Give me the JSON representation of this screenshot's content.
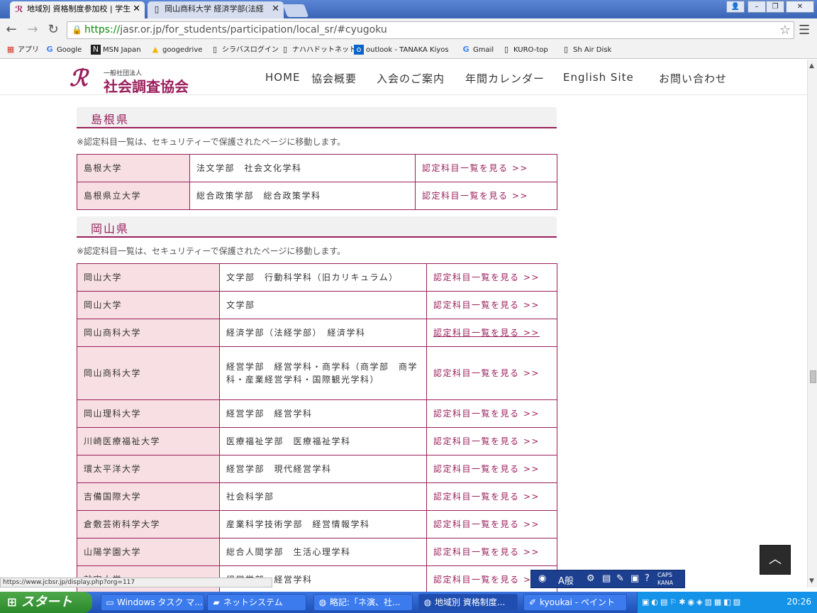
{
  "browser": {
    "tabs": [
      {
        "label": "地域別 資格制度参加校 | 学生",
        "active": true
      },
      {
        "label": "岡山商科大学 経済学部(法経",
        "active": false
      }
    ],
    "address": {
      "scheme": "https://",
      "rest": "jasr.or.jp/for_students/participation/local_sr/#cyugoku"
    },
    "bookmarks": [
      {
        "label": "アプリ",
        "icon": "apps-icon"
      },
      {
        "label": "Google",
        "icon": "google-icon"
      },
      {
        "label": "MSN Japan",
        "icon": "msn-icon"
      },
      {
        "label": "googedrive",
        "icon": "drive-icon"
      },
      {
        "label": "シラバスログイン",
        "icon": "page-icon"
      },
      {
        "label": "ナハハドットネット",
        "icon": "page-icon"
      },
      {
        "label": "outlook - TANAKA Kiyos",
        "icon": "outlook-icon"
      },
      {
        "label": "Gmail",
        "icon": "google-icon"
      },
      {
        "label": "KURO-top",
        "icon": "page-icon"
      },
      {
        "label": "Sh Air Disk",
        "icon": "page-icon"
      }
    ]
  },
  "site": {
    "logo_small": "一般社団法人",
    "logo_name": "社会調査協会",
    "nav": [
      "HOME",
      "協会概要",
      "入会のご案内",
      "年間カレンダー",
      "English Site",
      "お問い合わせ"
    ]
  },
  "sections": [
    {
      "pref": "島根県",
      "note": "※認定科目一覧は、セキュリティーで保護されたページに移動します。",
      "rows": [
        {
          "name": "島根大学",
          "dept": "法文学部　社会文化学科",
          "link": "認定科目一覧を見る >>"
        },
        {
          "name": "島根県立大学",
          "dept": "総合政策学部　総合政策学科",
          "link": "認定科目一覧を見る >>"
        }
      ]
    },
    {
      "pref": "岡山県",
      "note": "※認定科目一覧は、セキュリティーで保護されたページに移動します。",
      "rows": [
        {
          "name": "岡山大学",
          "dept": "文学部　行動科学科（旧カリキュラム）",
          "link": "認定科目一覧を見る >>"
        },
        {
          "name": "岡山大学",
          "dept": "文学部",
          "link": "認定科目一覧を見る >>"
        },
        {
          "name": "岡山商科大学",
          "dept": "経済学部（法経学部）　経済学科",
          "link": "認定科目一覧を見る >>"
        },
        {
          "name": "岡山商科大学",
          "dept": "経営学部　経営学科・商学科（商学部　商学科・産業経営学科・国際観光学科）",
          "link": "認定科目一覧を見る >>"
        },
        {
          "name": "岡山理科大学",
          "dept": "経営学部　経営学科",
          "link": "認定科目一覧を見る >>"
        },
        {
          "name": "川崎医療福祉大学",
          "dept": "医療福祉学部　医療福祉学科",
          "link": "認定科目一覧を見る >>"
        },
        {
          "name": "環太平洋大学",
          "dept": "経営学部　現代経営学科",
          "link": "認定科目一覧を見る >>"
        },
        {
          "name": "吉備国際大学",
          "dept": "社会科学部",
          "link": "認定科目一覧を見る >>"
        },
        {
          "name": "倉敷芸術科学大学",
          "dept": "産業科学技術学部　経営情報学科",
          "link": "認定科目一覧を見る >>"
        },
        {
          "name": "山陽学園大学",
          "dept": "総合人間学部　生活心理学科",
          "link": "認定科目一覧を見る >>"
        },
        {
          "name": "就実大学",
          "dept": "経営学部　経営学科",
          "link": "認定科目一覧を見る >>"
        }
      ]
    }
  ],
  "status_url": "https://www.jcbsr.jp/display.php?org=117",
  "ime": {
    "mode": "A般",
    "caps": "CAPS",
    "kana": "KANA"
  },
  "taskbar": {
    "start": "スタート",
    "tasks": [
      {
        "label": "Windows タスク マ...",
        "icon": "monitor-icon"
      },
      {
        "label": "ネットシステム",
        "icon": "folder-icon"
      },
      {
        "label": "略記:「ネ演、社...",
        "icon": "chrome-icon"
      },
      {
        "label": "地域別 資格制度...",
        "icon": "chrome-icon"
      },
      {
        "label": "kyoukai - ペイント",
        "icon": "paint-icon"
      }
    ],
    "clock": "20:26"
  }
}
